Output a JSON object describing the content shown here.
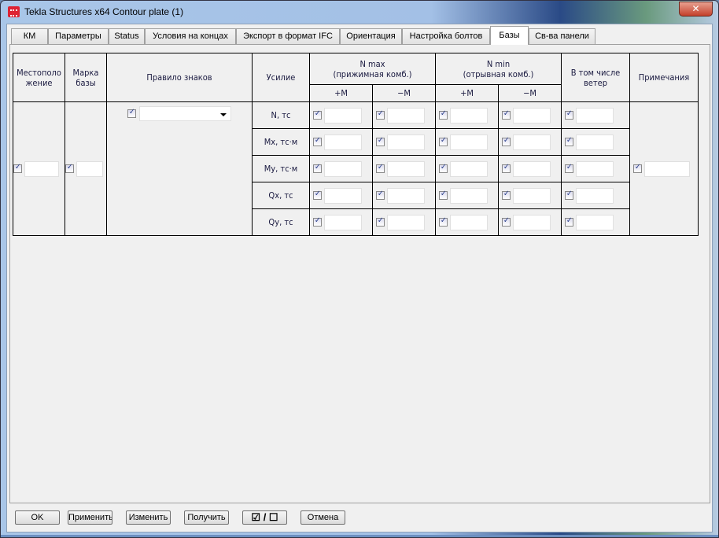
{
  "window": {
    "title": "Tekla Structures x64  Contour plate (1)",
    "close": "✕"
  },
  "tabs": [
    "КМ",
    "Параметры",
    "Status",
    "Условия на концах",
    "Экспорт в формат IFC",
    "Ориентация",
    "Настройка болтов",
    "Базы",
    "Св-ва панели"
  ],
  "active_tab": "Базы",
  "table": {
    "headers": {
      "location": "Местоположение",
      "base_mark": "Марка базы",
      "sign_rule": "Правило знаков",
      "force": "Усилие",
      "nmax": "N max",
      "nmax_sub": "(прижимная комб.)",
      "nmin": "N min",
      "nmin_sub": "(отрывная комб.)",
      "wind": "В том числе ветер",
      "notes": "Примечания",
      "plus_m": "+M",
      "minus_m": "−M"
    },
    "forces": [
      "N, тс",
      "Mx, тс·м",
      "My, тс·м",
      "Qx, тс",
      "Qy, тс"
    ]
  },
  "buttons": {
    "ok": "OK",
    "apply": "Применить",
    "modify": "Изменить",
    "get": "Получить",
    "toggle": "☑ / ☐",
    "cancel": "Отмена"
  }
}
